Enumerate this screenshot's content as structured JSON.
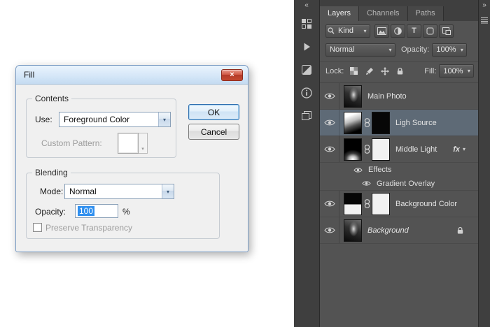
{
  "icons": {
    "close": "×",
    "dropdown_arrow": "▾",
    "collapse_left": "«",
    "collapse_right": "»",
    "chevron_down": "▾",
    "type_T": "T"
  },
  "fill_dialog": {
    "title": "Fill",
    "contents": {
      "legend": "Contents",
      "use_label": "Use:",
      "use_value": "Foreground Color",
      "custom_pattern_label": "Custom Pattern:"
    },
    "ok_label": "OK",
    "cancel_label": "Cancel",
    "blending": {
      "legend": "Blending",
      "mode_label": "Mode:",
      "mode_value": "Normal",
      "opacity_label": "Opacity:",
      "opacity_value": "100",
      "opacity_unit": "%",
      "preserve_label": "Preserve Transparency",
      "preserve_checked": false
    }
  },
  "layers_panel": {
    "tabs": [
      {
        "label": "Layers",
        "active": true
      },
      {
        "label": "Channels",
        "active": false
      },
      {
        "label": "Paths",
        "active": false
      }
    ],
    "filter": {
      "kind_label": "Kind"
    },
    "blend": {
      "mode_value": "Normal",
      "opacity_label": "Opacity:",
      "opacity_value": "100%"
    },
    "lock": {
      "label": "Lock:",
      "fill_label": "Fill:",
      "fill_value": "100%"
    },
    "layers": [
      {
        "name": "Main Photo",
        "selected": false
      },
      {
        "name": "Ligh Source",
        "selected": true
      },
      {
        "name": "Middle Light",
        "selected": false,
        "fx_label": "fx"
      },
      {
        "name": "Background Color",
        "selected": false
      },
      {
        "name": "Background",
        "selected": false,
        "locked": true
      }
    ],
    "effects": {
      "label": "Effects",
      "item": "Gradient Overlay"
    }
  }
}
